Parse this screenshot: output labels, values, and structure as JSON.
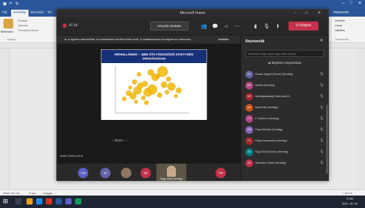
{
  "word": {
    "tabs": [
      "Fájl",
      "Kezdőlap",
      "Beszúrás",
      "Ter"
    ],
    "paste_label": "Beillesztés",
    "clipboard_label": "Vágólap",
    "ribbon_items": [
      "Kivágás",
      "Másolás",
      "Formátummásoló"
    ],
    "right_ribbon": [
      "Keresés",
      "Csere",
      "Kijelölés",
      "Szerkesztés"
    ],
    "status_page": "Oldal: 18 / 18",
    "status_words": "0 szó",
    "status_lang": "magyar",
    "zoom": "+ 110 %",
    "title_right": "Megosztás"
  },
  "teams": {
    "window_title": "Microsoft Teams",
    "timer": "47:14",
    "share_label": "Irányítás átvétele",
    "leave_label": "Kilépés",
    "banner_text": "A rögzítés elkezdődött. Az értekezleten tévékel lehet kerül. A csatlakozással hozzájárul az értekezlet...",
    "banner_link": "Beállítás",
    "slide": {
      "title_line1": "HŐHULLÁMOK – 1880 ÓTA FOKOZÓDÓ KITETTSÉG",
      "title_line2": "ORSZÁGOSAN"
    },
    "slide_nav": "30/33",
    "share_caption": "Vadóc Ámeny",
    "share_caption_suffix": "(ért)",
    "participants_bar": [
      {
        "label": "+26",
        "color": "#5b5fc7"
      },
      {
        "label": "KI",
        "color": "#6264a7"
      },
      {
        "label": "",
        "color": "#8d7360"
      },
      {
        "label": "SZ",
        "color": "#c4314b"
      },
      {
        "label": "HR",
        "color": "#c4314b"
      }
    ],
    "video_caption": "Nagy Zsolt (Vendég)",
    "panel": {
      "title": "Résztvevők",
      "search_placeholder": "Személy meghívása vagy szám tárcsá",
      "invite_label": "Meghívó megosztása",
      "people": [
        {
          "initials": "RJ",
          "name": "Rózsa Jegyző (Guest) (Vendég)",
          "color": "#6264a7"
        },
        {
          "initials": "MV",
          "name": "Marika (Vendég)",
          "color": "#b24782"
        },
        {
          "initials": "MÖ",
          "name": "Mecőgazdasági Ösztrováll (V...",
          "color": "#a4262c"
        },
        {
          "initials": "NE",
          "name": "Nyuli Edit (Vendég)",
          "color": "#ca5010"
        },
        {
          "initials": "PZ",
          "name": "P. Zsolt ev (Vendég)",
          "color": "#b24782"
        },
        {
          "initials": "PM",
          "name": "Pápai Mónika (Vendég)",
          "color": "#8764b8"
        },
        {
          "initials": "PZ",
          "name": "Pápai Zsuzsanna (Vendég)",
          "color": "#a4262c"
        },
        {
          "initials": "SZ",
          "name": "Sági Zsolt (Guest) (Vendég)",
          "color": "#038387"
        },
        {
          "initials": "SZ",
          "name": "Sinkovics Zoltán (Vendég)",
          "color": "#c4314b"
        }
      ]
    }
  },
  "taskbar": {
    "time": "17:51",
    "date": "2021. 06. 16."
  },
  "chart_data": {
    "type": "scatter",
    "title": "",
    "xlabel": "",
    "ylabel": "",
    "xlim": [
      0,
      10
    ],
    "ylim": [
      0,
      10
    ],
    "series": [
      {
        "x": [
          1.2,
          1.8,
          2.4,
          2.0,
          3.0,
          2.6,
          3.4,
          3.8,
          4.4,
          4.0,
          5.0,
          5.4,
          6.0,
          6.6,
          7.0,
          7.6,
          8.2,
          8.6,
          3.2,
          4.8,
          5.8,
          6.4,
          7.2,
          2.8,
          4.2
        ],
        "y": [
          3.0,
          4.2,
          3.6,
          5.4,
          4.8,
          6.6,
          5.8,
          3.2,
          4.4,
          6.2,
          5.0,
          7.6,
          3.8,
          6.0,
          4.4,
          5.6,
          3.6,
          4.8,
          8.2,
          8.6,
          7.8,
          8.8,
          7.2,
          2.4,
          2.2
        ],
        "size": [
          1.4,
          1.8,
          2.2,
          1.2,
          2.6,
          1.6,
          2.0,
          1.4,
          2.8,
          1.8,
          3.2,
          2.4,
          1.6,
          2.0,
          1.4,
          2.6,
          1.2,
          1.8,
          1.4,
          2.0,
          1.2,
          3.4,
          1.6,
          1.2,
          1.4
        ]
      }
    ]
  }
}
